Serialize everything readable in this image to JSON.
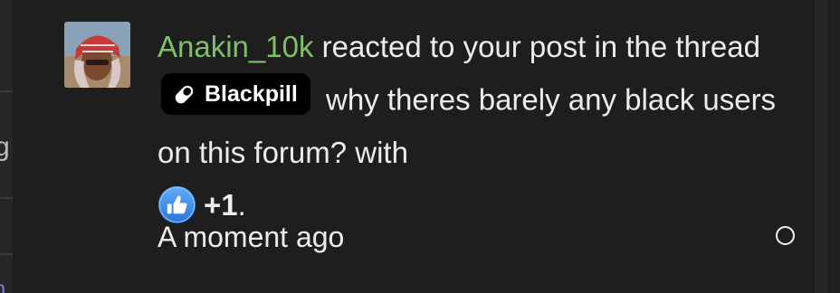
{
  "notification": {
    "username": "Anakin_10k",
    "text_before_prefix": " reacted to your post in the thread ",
    "thread_prefix": "Blackpill",
    "text_after_prefix": " why theres barely any black users on this forum? with ",
    "reaction_label": "+1",
    "trailing": ".",
    "timestamp": "A moment ago"
  },
  "icons": {
    "avatar": "user-avatar",
    "prefix_icon": "pill-icon",
    "reaction_icon": "thumbs-up-icon",
    "mark_read": "circle-icon"
  },
  "colors": {
    "background": "#1e1e1e",
    "username": "#7fbf6a",
    "text": "#ececec",
    "prefix_bg": "#000000",
    "reaction_blue": "#3b8ff0"
  }
}
